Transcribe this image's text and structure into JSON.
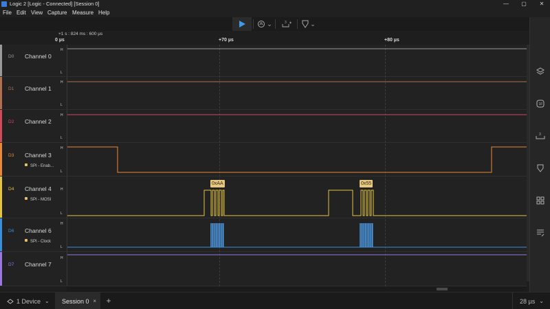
{
  "window": {
    "title": "Logic 2 [Logic - Connected] [Session 0]",
    "minimize": "—",
    "maximize": "▢",
    "close": "✕"
  },
  "menu": [
    "File",
    "Edit",
    "View",
    "Capture",
    "Measure",
    "Help"
  ],
  "toolbar": {
    "play_icon": "play-icon",
    "trigger_icon": "trigger-icon",
    "measure_icon": "measure-icon",
    "measure_glyph": "3",
    "marker_icon": "marker-icon",
    "dropdown_glyph": "⌄"
  },
  "timeline": {
    "base": "+1 s : 824 ms : 600 µs",
    "ticks": [
      "+70 µs",
      "+80 µs"
    ],
    "left_edge_tick": "0 µs"
  },
  "channels": [
    {
      "id": "D0",
      "name": "Channel 0",
      "color": "#9a9a9a",
      "annotation": ""
    },
    {
      "id": "D1",
      "name": "Channel 1",
      "color": "#b07050",
      "annotation": ""
    },
    {
      "id": "D2",
      "name": "Channel 2",
      "color": "#d04a5a",
      "annotation": ""
    },
    {
      "id": "D3",
      "name": "Channel 3",
      "color": "#e88a3a",
      "annotation": "SPI - Enab..."
    },
    {
      "id": "D4",
      "name": "Channel 4",
      "color": "#e5c53e",
      "annotation": "SPI - MOSI"
    },
    {
      "id": "D6",
      "name": "Channel 6",
      "color": "#3a8fd8",
      "annotation": "SPI - Clock"
    },
    {
      "id": "D7",
      "name": "Channel 7",
      "color": "#9a78e0",
      "annotation": ""
    }
  ],
  "level_labels": {
    "high": "H",
    "low": "L"
  },
  "decoded": [
    {
      "value": "0xAA"
    },
    {
      "value": "0x55"
    }
  ],
  "status": {
    "device": "1 Device",
    "session": "Session 0",
    "session_close": "×",
    "add": "+",
    "zoom": "28 µs"
  },
  "colors": {
    "play": "#3d9be9",
    "decode_badge": "#e9c77d",
    "background": "#1e1e1e"
  },
  "right_panel_icons": [
    "layers-icon",
    "analyzer-icon",
    "measure-icon",
    "marker-icon",
    "extensions-icon",
    "notes-icon"
  ]
}
